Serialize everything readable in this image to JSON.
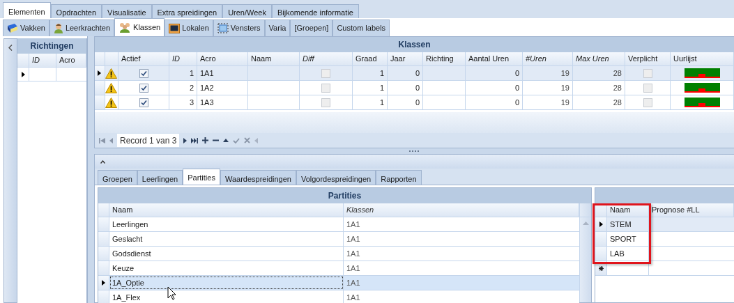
{
  "top_tabs": [
    {
      "label": "Elementen",
      "selected": true
    },
    {
      "label": "Opdrachten",
      "selected": false
    },
    {
      "label": "Visualisatie",
      "selected": false
    },
    {
      "label": "Extra spreidingen",
      "selected": false
    },
    {
      "label": "Uren/Week",
      "selected": false
    },
    {
      "label": "Bijkomende informatie",
      "selected": false
    }
  ],
  "sub_tabs": [
    {
      "label": "Vakken",
      "selected": false,
      "kind": "book"
    },
    {
      "label": "Leerkrachten",
      "selected": false,
      "kind": "person"
    },
    {
      "label": "Klassen",
      "selected": true,
      "kind": "people"
    },
    {
      "label": "Lokalen",
      "selected": false,
      "kind": "screen"
    },
    {
      "label": "Vensters",
      "selected": false,
      "kind": "frame"
    },
    {
      "label": "Varia",
      "selected": false,
      "kind": "none"
    },
    {
      "label": "[Groepen]",
      "selected": false,
      "kind": "none"
    },
    {
      "label": "Custom labels",
      "selected": false,
      "kind": "none"
    }
  ],
  "richtingen": {
    "title": "Richtingen",
    "columns": [
      {
        "label": "ID",
        "italic": true
      },
      {
        "label": "Acro",
        "italic": false
      }
    ]
  },
  "klassen": {
    "title": "Klassen",
    "columns": [
      {
        "label": "Actief",
        "italic": false
      },
      {
        "label": "ID",
        "italic": true
      },
      {
        "label": "Acro",
        "italic": false
      },
      {
        "label": "Naam",
        "italic": false
      },
      {
        "label": "Diff",
        "italic": true
      },
      {
        "label": "Graad",
        "italic": false
      },
      {
        "label": "Jaar",
        "italic": false
      },
      {
        "label": "Richting",
        "italic": false
      },
      {
        "label": "Aantal Uren",
        "italic": false
      },
      {
        "label": "#Uren",
        "italic": true
      },
      {
        "label": "Max Uren",
        "italic": true
      },
      {
        "label": "Verplicht",
        "italic": false
      },
      {
        "label": "Uurlijst",
        "italic": false
      }
    ],
    "rows": [
      {
        "selected": true,
        "warning": true,
        "actief": true,
        "id": "1",
        "acro": "1A1",
        "diff": false,
        "graad": "1",
        "jaar": "0",
        "aantal_uren": "0",
        "uren": "19",
        "max_uren": "28",
        "verplicht": false
      },
      {
        "selected": false,
        "warning": true,
        "actief": true,
        "id": "2",
        "acro": "1A2",
        "diff": false,
        "graad": "1",
        "jaar": "0",
        "aantal_uren": "0",
        "uren": "19",
        "max_uren": "28",
        "verplicht": false
      },
      {
        "selected": false,
        "warning": true,
        "actief": true,
        "id": "3",
        "acro": "1A3",
        "diff": false,
        "graad": "1",
        "jaar": "0",
        "aantal_uren": "0",
        "uren": "19",
        "max_uren": "28",
        "verplicht": false
      }
    ]
  },
  "navigator": {
    "record": "Record 1 van 3"
  },
  "bottom_tabs": [
    {
      "label": "Groepen",
      "selected": false
    },
    {
      "label": "Leerlingen",
      "selected": false
    },
    {
      "label": "Partities",
      "selected": true
    },
    {
      "label": "Waardespreidingen",
      "selected": false
    },
    {
      "label": "Volgordespreidingen",
      "selected": false
    },
    {
      "label": "Rapporten",
      "selected": false
    }
  ],
  "partities": {
    "title": "Partities",
    "columns": [
      {
        "label": "Naam",
        "italic": false
      },
      {
        "label": "Klassen",
        "italic": true
      }
    ],
    "rows": [
      {
        "naam": "Leerlingen",
        "klassen": "1A1",
        "selected": false
      },
      {
        "naam": "Geslacht",
        "klassen": "1A1",
        "selected": false
      },
      {
        "naam": "Godsdienst",
        "klassen": "1A1",
        "selected": false
      },
      {
        "naam": "Keuze",
        "klassen": "1A1",
        "selected": false
      },
      {
        "naam": "1A_Optie",
        "klassen": "1A1",
        "selected": true
      },
      {
        "naam": "1A_Flex",
        "klassen": "1A1",
        "selected": false
      }
    ]
  },
  "opties": {
    "highlighted": true,
    "columns": [
      "Naam",
      "Prognose #LL"
    ],
    "rows": [
      {
        "naam": "STEM",
        "selected": true
      },
      {
        "naam": "SPORT",
        "selected": false
      },
      {
        "naam": "LAB",
        "selected": false
      }
    ]
  }
}
